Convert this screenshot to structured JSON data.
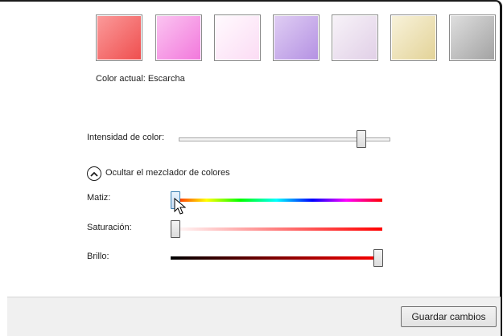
{
  "swatches": [
    {
      "name": "swatch-red",
      "color": "#f47070"
    },
    {
      "name": "swatch-pink",
      "color": "#f79ae6"
    },
    {
      "name": "swatch-light-pink",
      "color": "#fde9f8"
    },
    {
      "name": "swatch-lavender",
      "color": "#c6a8e8"
    },
    {
      "name": "swatch-frost",
      "color": "#ebe0ef"
    },
    {
      "name": "swatch-cream",
      "color": "#ede2b9"
    },
    {
      "name": "swatch-gray",
      "color": "#bcbcbc"
    }
  ],
  "current_color": {
    "label": "Color actual:",
    "value": "Escarcha"
  },
  "intensity": {
    "label": "Intensidad de color:",
    "level": 0.86
  },
  "mixer_toggle": {
    "label": "Ocultar el mezclador de colores",
    "icon": "chevron-up-icon"
  },
  "hue": {
    "label": "Matiz:",
    "level": 0.02
  },
  "saturation": {
    "label": "Saturación:",
    "level": 0.0
  },
  "brightness": {
    "label": "Brillo:",
    "level": 1.0
  },
  "footer": {
    "save_label": "Guardar cambios"
  }
}
